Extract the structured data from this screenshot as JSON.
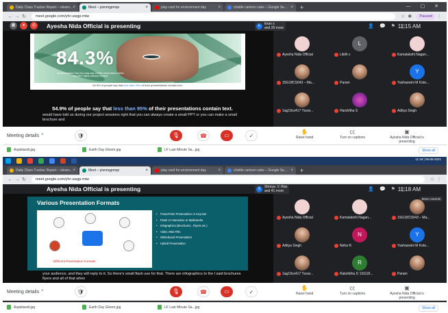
{
  "shot1": {
    "tabs": [
      "Daily Class Tracker Report – elearn...",
      "Meet – pisnmgpmqo",
      "play card for environment day",
      "chattle cartoon cake – Google Se..."
    ],
    "url": "meet.google.com/yhr-uwgp-mtw",
    "profile": "Paused",
    "present_title": "Ayesha Nida Official is presenting",
    "presenter_chip": {
      "avatar": "k",
      "line1": "kiran s",
      "line2": "and 29 more"
    },
    "clock": "11:15 AM",
    "slide": {
      "big_stat": "84.3%",
      "small_stat": "All presentation that your way stay crafted presentation slides that were highly visually focused.",
      "footer_pre": "94.9% of people say that ",
      "footer_hi": "less than 95%",
      "footer_post": " of their presentations contain text."
    },
    "caption_big_pre": "54.9% of people say that ",
    "caption_big_hi": "less than 95%",
    "caption_big_post": " of their presentations contain text.",
    "caption_small": "would have told us during our project sessions right that you can always create a small PPT or you can make a small brochure and",
    "participants": [
      {
        "name": "Ayesha Nida Official",
        "avatar": "",
        "type": "card"
      },
      {
        "name": "Likith c",
        "avatar": "L",
        "color": "#5f6368"
      },
      {
        "name": "Kamalakshi Nagan...",
        "avatar": "",
        "type": "card"
      },
      {
        "name": "15G18CS043 – Ma...",
        "avatar": "",
        "type": "photo"
      },
      {
        "name": "Param",
        "avatar": "",
        "type": "photo"
      },
      {
        "name": "Yashaswini M Kote...",
        "avatar": "Y",
        "color": "#1a73e8"
      },
      {
        "name": "1ag19cs417 Yuvar...",
        "avatar": "",
        "type": "photo"
      },
      {
        "name": "Harshitha S",
        "avatar": "",
        "type": "flower"
      },
      {
        "name": "Aditya Singh",
        "avatar": "",
        "type": "photo"
      }
    ],
    "meeting_details": "Meeting details",
    "raise_hand": "Raise hand",
    "captions": "Turn on captions",
    "presenting_status": "Ayesha Nida Official is presenting",
    "downloads": [
      "Asplelasdt.jpg",
      "Earth Day Gloom.jpg",
      "LF Last Minute Sa...jpg"
    ],
    "show_all": "Show all"
  },
  "shot2": {
    "taskbar_time": "11:19 | 05-06-2021",
    "tabs": [
      "Daily Class Tracker Report – elearn...",
      "Meet – pisnmgpmqo",
      "play card for environment day",
      "chattle cartoon cake – Google Se..."
    ],
    "url": "meet.google.com/yhr-uwgp-mtw",
    "present_title": "Ayesha Nida Official is presenting",
    "presenter_chip": {
      "avatar": "S",
      "line1": "Shreya. V. Rao",
      "line2": "and 41 more"
    },
    "clock": "11:18 AM",
    "more_controls": "More controls",
    "slide": {
      "title": "Various Presentation Formats",
      "diagram_label": "Different Presentation Formats",
      "bullets": [
        "PowerPoint Presentation or Keynote",
        "Flash or Interactive or Multimedia",
        "Infographics (Brochures , Flyers etc.)",
        "Video AND Film",
        "Whiteboard Presentation",
        "Hybrid Presentation"
      ]
    },
    "caption_small": "your audience, and they will reply to it. So there's small flash use for that. There are infographics to the l said brochures flyers and all of that when",
    "participants": [
      {
        "name": "Ayesha Nida Official",
        "avatar": "",
        "type": "card"
      },
      {
        "name": "Kamalakshi Nagan...",
        "avatar": "",
        "type": "card"
      },
      {
        "name": "1SG18CS043 – Ma...",
        "avatar": "",
        "type": "photo"
      },
      {
        "name": "Aditya Singh",
        "avatar": "",
        "type": "photo"
      },
      {
        "name": "Neha R",
        "avatar": "N",
        "color": "#c2185b"
      },
      {
        "name": "Yashaswini M Kote...",
        "avatar": "Y",
        "color": "#1a73e8"
      },
      {
        "name": "1ag19cs417 Yuvar...",
        "avatar": "",
        "type": "photo"
      },
      {
        "name": "Rakshitha D 1SG18...",
        "avatar": "R",
        "color": "#2e7d32"
      },
      {
        "name": "Param",
        "avatar": "",
        "type": "photo"
      }
    ],
    "meeting_details": "Meeting details",
    "raise_hand": "Raise hand",
    "captions": "Turn on captions",
    "presenting_status": "Ayesha Nida Official is presenting",
    "downloads": [
      "Asplelasdt.jpg",
      "Earth Day Gloom.jpg",
      "LF Last Minute Sa...jpg"
    ],
    "show_all": "Show all"
  },
  "colors": {
    "end_call": "#d93025",
    "mic_off": "#ea4335",
    "accent": "#1a73e8",
    "slide2_bg": "#0b5f6b"
  }
}
